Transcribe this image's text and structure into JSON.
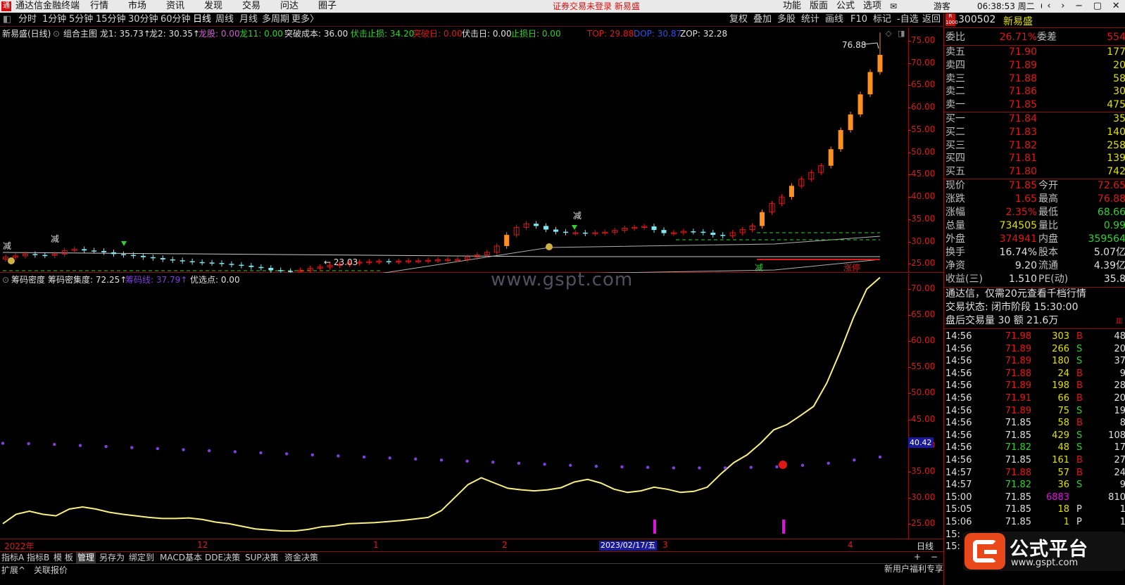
{
  "app": {
    "title": "通达信金融终端",
    "logo": "通",
    "notice": "证券交易未登录 新易盛",
    "clock": "06:38:53 周二",
    "user": "游客",
    "right_menu": [
      "功能",
      "版面",
      "公式",
      "选项"
    ]
  },
  "menu": [
    "行情",
    "市场",
    "资讯",
    "发现",
    "交易",
    "问达",
    "圈子"
  ],
  "periods": [
    "分时",
    "1分钟",
    "5分钟",
    "15分钟",
    "30分钟",
    "60分钟",
    "日线",
    "周线",
    "月线",
    "多周期",
    "更多〉"
  ],
  "toolbar": [
    "复权",
    "叠加",
    "多股",
    "统计",
    "画线",
    "F10",
    "标记",
    "-自选",
    "返回"
  ],
  "main_header": {
    "stock": "新易盛(日线)",
    "formula": "组合主图",
    "items": [
      {
        "label": "龙1: 35.73↑",
        "color": "#e0e0e0"
      },
      {
        "label": "龙2: 30.35↑",
        "color": "#e0e0e0"
      },
      {
        "label": "龙股: 0.00",
        "color": "#d060d0"
      },
      {
        "label": "龙11: 0.00",
        "color": "#30d030"
      },
      {
        "label": "突破成本: 36.00",
        "color": "#e0e0e0"
      },
      {
        "label": "伏击止损: 34.20",
        "color": "#30d030"
      },
      {
        "label": "突破日: 0.00",
        "color": "#e01818"
      },
      {
        "label": "伏击日: 0.00",
        "color": "#e0e0e0"
      },
      {
        "label": "止损日: 0.00",
        "color": "#30d030"
      },
      {
        "label": "TOP: 29.88",
        "color": "#e01818"
      },
      {
        "label": "DOP: 30.87",
        "color": "#3050e0"
      },
      {
        "label": "ZOP: 32.28",
        "color": "#e0e0e0"
      }
    ]
  },
  "main_axis": [
    "75.00",
    "70.00",
    "65.00",
    "60.00",
    "55.00",
    "50.00",
    "45.00",
    "40.00",
    "35.00",
    "30.00",
    "25.00"
  ],
  "main_labels": {
    "high": "76.88",
    "low": "23.03",
    "jian1": "减",
    "jian2": "减",
    "jian3": "减",
    "zt": "涨停",
    "jian_bottom": "减"
  },
  "sub_header": {
    "name": "筹码密度",
    "items": [
      {
        "label": "筹码密集度: 72.25↑",
        "color": "#e0e0e0"
      },
      {
        "label": "筹码线: 37.79↑",
        "color": "#8040e0"
      },
      {
        "label": "优选点: 0.00",
        "color": "#e0e0e0"
      }
    ]
  },
  "watermark": "www.gspt.com",
  "sub_axis": [
    "70.00",
    "65.00",
    "60.00",
    "55.00",
    "50.00",
    "45.00",
    "40.00",
    "35.00",
    "30.00",
    "25.00"
  ],
  "sub_marker": "40.42",
  "x_axis": {
    "labels": [
      "2022年",
      "12",
      "1",
      "2",
      "3",
      "4"
    ],
    "cursor_date": "2023/02/17/五",
    "period": "日线"
  },
  "tabs": [
    "指标A",
    "指标B",
    "模 板",
    "管理",
    "另存为",
    "绑定到",
    "MACD基本",
    "DDE决策",
    "SUP决策",
    "资金决策"
  ],
  "status": [
    "扩展^",
    "关联报价"
  ],
  "status_right": "新用户福利专享",
  "status_right2": "笔",
  "quote": {
    "code": "300502",
    "name": "新易盛",
    "weibi_label": "委比",
    "weibi": "26.71%",
    "weicha_label": "委差",
    "weicha": "554",
    "asks": [
      {
        "label": "卖五",
        "price": "71.90",
        "vol": "177"
      },
      {
        "label": "卖四",
        "price": "71.89",
        "vol": "20"
      },
      {
        "label": "卖三",
        "price": "71.88",
        "vol": "58"
      },
      {
        "label": "卖二",
        "price": "71.86",
        "vol": "30"
      },
      {
        "label": "卖一",
        "price": "71.85",
        "vol": "475"
      }
    ],
    "bids": [
      {
        "label": "买一",
        "price": "71.84",
        "vol": "35"
      },
      {
        "label": "买二",
        "price": "71.83",
        "vol": "140"
      },
      {
        "label": "买三",
        "price": "71.82",
        "vol": "258"
      },
      {
        "label": "买四",
        "price": "71.81",
        "vol": "139"
      },
      {
        "label": "买五",
        "price": "71.80",
        "vol": "742"
      }
    ],
    "stats": [
      {
        "l1": "现价",
        "v1": "71.85",
        "l2": "今开",
        "v2": "72.65",
        "c1": "#e01818",
        "c2": "#e01818"
      },
      {
        "l1": "涨跌",
        "v1": "1.65",
        "l2": "最高",
        "v2": "76.88",
        "c1": "#e01818",
        "c2": "#e01818"
      },
      {
        "l1": "涨幅",
        "v1": "2.35%",
        "l2": "最低",
        "v2": "68.66",
        "c1": "#e01818",
        "c2": "#30d030"
      },
      {
        "l1": "总量",
        "v1": "734505",
        "l2": "量比",
        "v2": "0.99",
        "c1": "#e0e000",
        "c2": "#30d030"
      },
      {
        "l1": "外盘",
        "v1": "374941",
        "l2": "内盘",
        "v2": "359564",
        "c1": "#e01818",
        "c2": "#30d030"
      },
      {
        "l1": "换手",
        "v1": "16.74%",
        "l2": "股本",
        "v2": "5.07亿",
        "c1": "#e0e0e0",
        "c2": "#e0e0e0"
      },
      {
        "l1": "净资",
        "v1": "9.20",
        "l2": "流通",
        "v2": "4.39亿",
        "c1": "#e0e0e0",
        "c2": "#e0e0e0"
      },
      {
        "l1": "收益(三)",
        "v1": "1.510",
        "l2": "PE(动)",
        "v2": "35.8",
        "c1": "#e0e0e0",
        "c2": "#e0e0e0"
      }
    ],
    "promo": "通达信，仅需20元查看千档行情",
    "trade_status": "交易状态: 闭市阶段 15:30:00",
    "after_hours": "盘后交易量 30 额 21.6万",
    "ticks": [
      {
        "t": "14:56",
        "p": "71.98",
        "v": "303",
        "d": "B",
        "n": "48"
      },
      {
        "t": "14:56",
        "p": "71.89",
        "v": "266",
        "d": "S",
        "n": "20"
      },
      {
        "t": "14:56",
        "p": "71.89",
        "v": "180",
        "d": "S",
        "n": "37"
      },
      {
        "t": "14:56",
        "p": "71.88",
        "v": "24",
        "d": "B",
        "n": "9"
      },
      {
        "t": "14:56",
        "p": "71.89",
        "v": "198",
        "d": "B",
        "n": "28"
      },
      {
        "t": "14:56",
        "p": "71.91",
        "v": "66",
        "d": "B",
        "n": "20"
      },
      {
        "t": "14:56",
        "p": "71.89",
        "v": "75",
        "d": "S",
        "n": "19"
      },
      {
        "t": "14:56",
        "p": "71.85",
        "v": "58",
        "d": "B",
        "n": "8"
      },
      {
        "t": "14:56",
        "p": "71.85",
        "v": "429",
        "d": "S",
        "n": "108"
      },
      {
        "t": "14:56",
        "p": "71.82",
        "v": "48",
        "d": "S",
        "n": "17"
      },
      {
        "t": "14:56",
        "p": "71.85",
        "v": "161",
        "d": "B",
        "n": "27"
      },
      {
        "t": "14:57",
        "p": "71.88",
        "v": "57",
        "d": "B",
        "n": "24"
      },
      {
        "t": "14:57",
        "p": "71.82",
        "v": "36",
        "d": "S",
        "n": "9"
      },
      {
        "t": "15:00",
        "p": "71.85",
        "v": "6883",
        "d": "",
        "n": "810"
      },
      {
        "t": "15:05",
        "p": "71.85",
        "v": "18",
        "d": "P",
        "n": "1"
      },
      {
        "t": "15:06",
        "p": "71.85",
        "v": "1",
        "d": "P",
        "n": "1"
      },
      {
        "t": "15:",
        "p": "",
        "v": "",
        "d": "",
        "n": ""
      },
      {
        "t": "15:",
        "p": "",
        "v": "",
        "d": "",
        "n": ""
      }
    ]
  },
  "logo_badge": {
    "big": "公式平台",
    "small": "www.gspt.com"
  },
  "colors": {
    "up": "#e01818",
    "down": "#30d030",
    "neutral": "#e0e0e0",
    "volume": "#e0e000",
    "chip_line": "#8040e0",
    "density_line": "#f8f080",
    "candle_down": "#80e8f0",
    "breakout": "#ff9020",
    "panel_border": "#8b1010"
  },
  "chart_data": [
    {
      "type": "candlestick",
      "title": "新易盛(日线)",
      "ylim": [
        23,
        78
      ],
      "close_approx": [
        26.5,
        26.8,
        27.2,
        27.0,
        26.9,
        27.2,
        28.0,
        28.3,
        28.0,
        27.9,
        27.6,
        27.2,
        27.0,
        26.8,
        26.5,
        26.3,
        26.0,
        25.8,
        25.6,
        25.4,
        25.3,
        25.2,
        25.0,
        24.8,
        24.6,
        24.3,
        24.1,
        23.6,
        23.4,
        23.3,
        23.6,
        24.0,
        24.3,
        24.7,
        24.9,
        25.2,
        25.4,
        25.5,
        25.6,
        25.5,
        25.6,
        25.7,
        25.7,
        25.8,
        25.9,
        26.0,
        26.0,
        26.5,
        27.0,
        27.6,
        29.0,
        31.5,
        33.2,
        34.0,
        33.5,
        32.7,
        32.2,
        32.0,
        32.0,
        31.8,
        32.0,
        32.1,
        32.5,
        33.0,
        33.2,
        33.4,
        32.6,
        31.9,
        32.0,
        32.3,
        32.2,
        32.0,
        31.5,
        31.3,
        32.0,
        32.7,
        33.5,
        36.6,
        38.5,
        40.0,
        42.5,
        44.0,
        45.5,
        47.0,
        50.7,
        55.0,
        58.5,
        63.0,
        68.0,
        71.85
      ],
      "high": 76.88,
      "low": 23.03
    },
    {
      "type": "line",
      "title": "筹码密度",
      "ylim": [
        22,
        73
      ],
      "series": [
        {
          "name": "筹码密集度",
          "values": [
            25.0,
            26.8,
            27.4,
            26.8,
            26.5,
            27.8,
            28.2,
            27.8,
            27.2,
            26.8,
            26.5,
            26.2,
            26.0,
            26.0,
            26.1,
            25.8,
            25.3,
            25.0,
            24.5,
            24.0,
            23.8,
            23.6,
            23.6,
            23.9,
            24.4,
            24.6,
            25.0,
            25.1,
            25.2,
            25.4,
            25.6,
            25.9,
            26.2,
            27.5,
            30.0,
            32.5,
            33.8,
            32.8,
            31.8,
            31.5,
            31.3,
            31.5,
            31.9,
            33.0,
            33.5,
            32.8,
            31.6,
            31.0,
            31.3,
            32.0,
            31.6,
            31.0,
            31.2,
            32.0,
            34.5,
            36.7,
            38.2,
            40.4,
            43.0,
            44.0,
            45.7,
            47.5,
            52.0,
            58.0,
            64.5,
            70.0,
            72.25
          ]
        },
        {
          "name": "筹码线",
          "values": [
            40.42,
            40.35,
            40.2,
            40.0,
            39.8,
            39.6,
            39.4,
            39.2,
            39.0,
            38.8,
            38.6,
            38.4,
            38.2,
            38.0,
            37.8,
            37.6,
            37.4,
            37.2,
            37.0,
            36.8,
            36.6,
            36.4,
            36.2,
            36.0,
            35.9,
            35.8,
            35.7,
            35.7,
            35.7,
            35.8,
            35.9,
            36.2,
            36.6,
            37.2,
            37.79
          ]
        }
      ]
    }
  ]
}
